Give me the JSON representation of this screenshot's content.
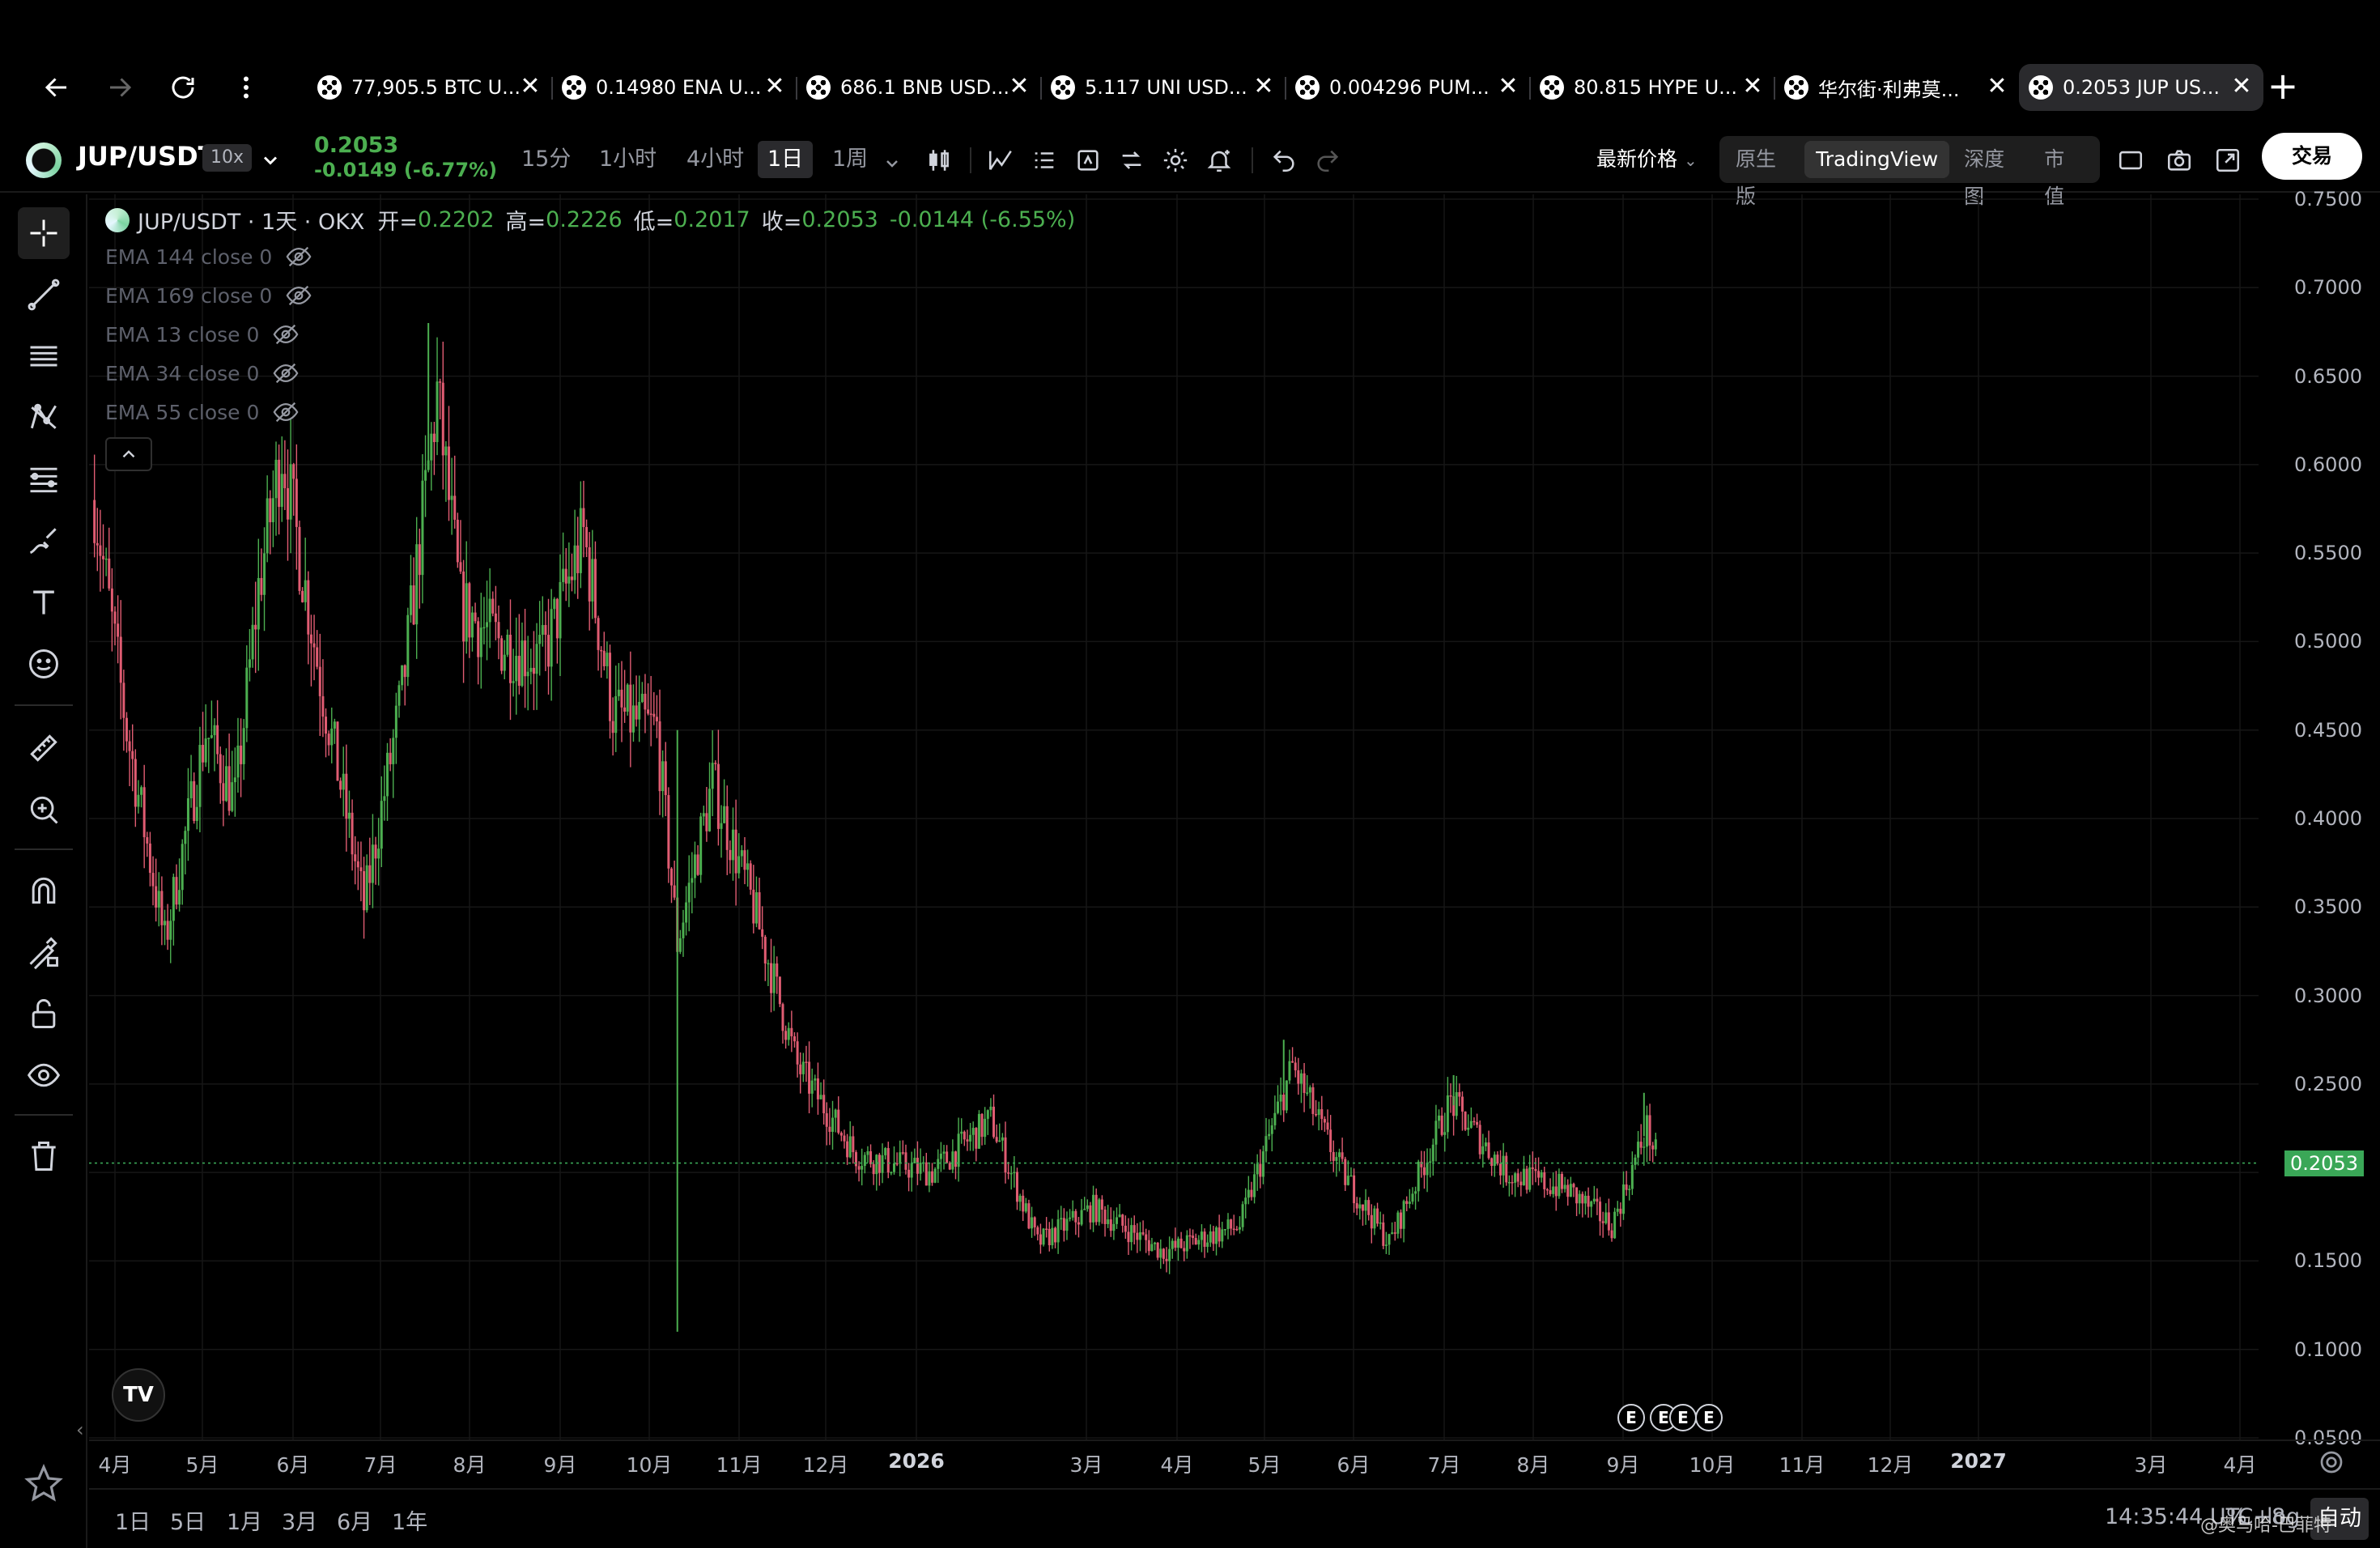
{
  "browser": {
    "tabs": [
      {
        "title": "77,905.5 BTC U...",
        "active": false
      },
      {
        "title": "0.14980 ENA U...",
        "active": false
      },
      {
        "title": "686.1 BNB USD...",
        "active": false
      },
      {
        "title": "5.117 UNI USD...",
        "active": false
      },
      {
        "title": "0.004296 PUM...",
        "active": false
      },
      {
        "title": "80.815 HYPE U...",
        "active": false
      },
      {
        "title": "华尔街·利弗莫...",
        "active": false
      },
      {
        "title": "0.2053 JUP US...",
        "active": true
      }
    ],
    "close_glyph": "✕",
    "new_tab_glyph": "+"
  },
  "toolbar": {
    "symbol": "JUP/USDT",
    "leverage": "10x",
    "last_price": "0.2053",
    "change": "-0.0149 (-6.77%)",
    "intervals": [
      {
        "label": "15分",
        "active": false
      },
      {
        "label": "1小时",
        "active": false
      },
      {
        "label": "4小时",
        "active": false
      },
      {
        "label": "1日",
        "active": true
      },
      {
        "label": "1周",
        "active": false
      }
    ],
    "price_type": "最新价格",
    "views": [
      {
        "label": "原生版",
        "active": false
      },
      {
        "label": "TradingView",
        "active": true
      },
      {
        "label": "深度图",
        "active": false
      },
      {
        "label": "市值",
        "active": false
      }
    ],
    "trade_button": "交易"
  },
  "legend": {
    "title": "JUP/USDT · 1天 · OKX",
    "open_label": "开=",
    "open": "0.2202",
    "high_label": "高=",
    "high": "0.2226",
    "low_label": "低=",
    "low": "0.2017",
    "close_label": "收=",
    "close": "0.2053",
    "change": "-0.0144 (-6.55%)",
    "indicators": [
      "EMA 144 close 0",
      "EMA 169 close 0",
      "EMA 13 close 0",
      "EMA 34 close 0",
      "EMA 55 close 0"
    ]
  },
  "price_axis": {
    "ticks": [
      "0.7500",
      "0.7000",
      "0.6500",
      "0.6000",
      "0.5500",
      "0.5000",
      "0.4500",
      "0.4000",
      "0.3500",
      "0.3000",
      "0.2500",
      "0.2053",
      "0.1500",
      "0.1000",
      "0.0500"
    ],
    "last_price_label": "0.2053"
  },
  "time_axis": {
    "ticks": [
      {
        "label": "4月",
        "year": false
      },
      {
        "label": "5月",
        "year": false
      },
      {
        "label": "6月",
        "year": false
      },
      {
        "label": "7月",
        "year": false
      },
      {
        "label": "8月",
        "year": false
      },
      {
        "label": "9月",
        "year": false
      },
      {
        "label": "10月",
        "year": false
      },
      {
        "label": "11月",
        "year": false
      },
      {
        "label": "12月",
        "year": false
      },
      {
        "label": "2026",
        "year": true
      },
      {
        "label": "3月",
        "year": false
      },
      {
        "label": "4月",
        "year": false
      },
      {
        "label": "5月",
        "year": false
      },
      {
        "label": "6月",
        "year": false
      },
      {
        "label": "7月",
        "year": false
      },
      {
        "label": "8月",
        "year": false
      },
      {
        "label": "9月",
        "year": false
      },
      {
        "label": "10月",
        "year": false
      },
      {
        "label": "11月",
        "year": false
      },
      {
        "label": "12月",
        "year": false
      },
      {
        "label": "2027",
        "year": true
      },
      {
        "label": "3月",
        "year": false
      },
      {
        "label": "4月",
        "year": false
      }
    ],
    "event_badges": [
      "E",
      "E",
      "E",
      "E"
    ]
  },
  "range_bar": {
    "ranges": [
      "1日",
      "5日",
      "1月",
      "3月",
      "6月",
      "1年"
    ],
    "clock": "14:35:44 UTC+8",
    "percent": "%",
    "log": "log",
    "auto": "自动"
  },
  "watermark": "@奥马哈-巴菲特",
  "chart_data": {
    "type": "candlestick",
    "symbol": "JUP/USDT",
    "interval": "1天",
    "exchange": "OKX",
    "ylim": [
      0.05,
      0.75
    ],
    "last_price": 0.2053,
    "up_color": "#4caf50",
    "down_color": "#e05c72",
    "monthly_path": [
      {
        "x": "2025-03-25",
        "y": 0.58
      },
      {
        "x": "2025-04-05",
        "y": 0.45
      },
      {
        "x": "2025-04-18",
        "y": 0.33
      },
      {
        "x": "2025-05-02",
        "y": 0.45
      },
      {
        "x": "2025-05-12",
        "y": 0.41
      },
      {
        "x": "2025-05-20",
        "y": 0.53
      },
      {
        "x": "2025-05-28",
        "y": 0.61
      },
      {
        "x": "2025-06-10",
        "y": 0.48
      },
      {
        "x": "2025-06-25",
        "y": 0.35
      },
      {
        "x": "2025-07-08",
        "y": 0.47
      },
      {
        "x": "2025-07-20",
        "y": 0.64
      },
      {
        "x": "2025-07-28",
        "y": 0.52
      },
      {
        "x": "2025-08-10",
        "y": 0.5
      },
      {
        "x": "2025-08-25",
        "y": 0.49
      },
      {
        "x": "2025-09-08",
        "y": 0.56
      },
      {
        "x": "2025-09-18",
        "y": 0.46
      },
      {
        "x": "2025-10-03",
        "y": 0.45
      },
      {
        "x": "2025-10-10",
        "y": 0.33
      },
      {
        "x": "2025-10-22",
        "y": 0.42
      },
      {
        "x": "2025-11-05",
        "y": 0.35
      },
      {
        "x": "2025-11-20",
        "y": 0.26
      },
      {
        "x": "2025-12-10",
        "y": 0.21
      },
      {
        "x": "2026-01-05",
        "y": 0.2
      },
      {
        "x": "2026-01-25",
        "y": 0.23
      },
      {
        "x": "2026-02-10",
        "y": 0.16
      },
      {
        "x": "2026-03-01",
        "y": 0.18
      },
      {
        "x": "2026-03-25",
        "y": 0.155
      },
      {
        "x": "2026-04-20",
        "y": 0.17
      },
      {
        "x": "2026-05-08",
        "y": 0.26
      },
      {
        "x": "2026-05-25",
        "y": 0.2
      },
      {
        "x": "2026-06-10",
        "y": 0.16
      },
      {
        "x": "2026-07-01",
        "y": 0.24
      },
      {
        "x": "2026-07-20",
        "y": 0.2
      },
      {
        "x": "2026-08-10",
        "y": 0.19
      },
      {
        "x": "2026-08-25",
        "y": 0.17
      },
      {
        "x": "2026-09-06",
        "y": 0.225
      },
      {
        "x": "2026-09-10",
        "y": 0.2053
      }
    ],
    "spikes": [
      {
        "x": "2025-07-17",
        "high": 0.68
      },
      {
        "x": "2025-10-10",
        "low": 0.11,
        "high": 0.45
      },
      {
        "x": "2026-05-05",
        "high": 0.275
      },
      {
        "x": "2026-07-02",
        "high": 0.255
      },
      {
        "x": "2026-09-05",
        "high": 0.245
      }
    ]
  }
}
